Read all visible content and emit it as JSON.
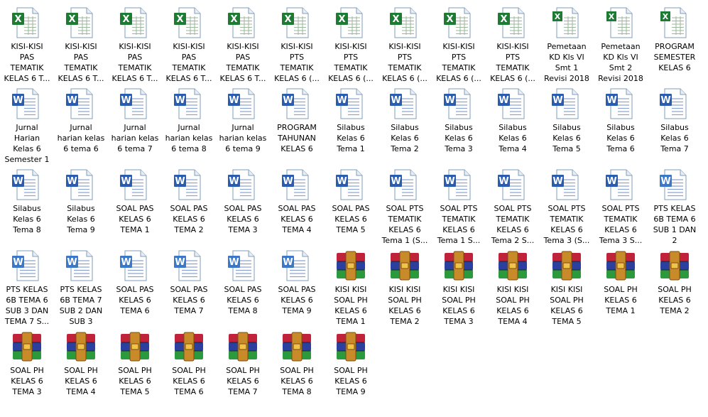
{
  "colors": {
    "excel_green": "#1e7b34",
    "word_blue": "#2a5cb0",
    "rar_red": "#c0223a",
    "rar_green": "#2a9a3c",
    "rar_blue": "#2b3f9e"
  },
  "files": [
    {
      "label": "KISI-KISI\nPAS\nTEMATIK\nKELAS 6 T...",
      "icon": "excel-icon"
    },
    {
      "label": "KISI-KISI\nPAS\nTEMATIK\nKELAS 6 T...",
      "icon": "excel-icon"
    },
    {
      "label": "KISI-KISI\nPAS\nTEMATIK\nKELAS 6 T...",
      "icon": "excel-icon"
    },
    {
      "label": "KISI-KISI\nPAS\nTEMATIK\nKELAS 6 T...",
      "icon": "excel-icon"
    },
    {
      "label": "KISI-KISI\nPAS\nTEMATIK\nKELAS 6 T...",
      "icon": "excel-icon"
    },
    {
      "label": "KISI-KISI\nPTS\nTEMATIK\nKELAS 6 (...",
      "icon": "excel-icon"
    },
    {
      "label": "KISI-KISI\nPTS\nTEMATIK\nKELAS 6 (...",
      "icon": "excel-icon"
    },
    {
      "label": "KISI-KISI\nPTS\nTEMATIK\nKELAS 6 (...",
      "icon": "excel-icon"
    },
    {
      "label": "KISI-KISI\nPTS\nTEMATIK\nKELAS 6 (...",
      "icon": "excel-icon"
    },
    {
      "label": "KISI-KISI\nPTS\nTEMATIK\nKELAS 6 (...",
      "icon": "excel-icon"
    },
    {
      "label": "Pemetaan\nKD Kls VI\nSmt 1\nRevisi 2018",
      "icon": "excel-sheet-icon"
    },
    {
      "label": "Pemetaan\nKD Kls VI\nSmt 2\nRevisi 2018",
      "icon": "excel-sheet-icon"
    },
    {
      "label": "PROGRAM\nSEMESTER\nKELAS 6",
      "icon": "excel-sheet-icon"
    },
    {
      "label": "Jurnal\nHarian\nKelas 6\nSemester 1",
      "icon": "word-icon"
    },
    {
      "label": "Jurnal\nharian kelas\n6 tema 6",
      "icon": "word-icon"
    },
    {
      "label": "Jurnal\nharian kelas\n6 tema 7",
      "icon": "word-icon"
    },
    {
      "label": "Jurnal\nharian kelas\n6 tema 8",
      "icon": "word-icon"
    },
    {
      "label": "Jurnal\nharian kelas\n6 tema 9",
      "icon": "word-icon"
    },
    {
      "label": "PROGRAM\nTAHUNAN\nKELAS 6",
      "icon": "word-icon"
    },
    {
      "label": "Silabus\nKelas 6\nTema 1",
      "icon": "word-icon"
    },
    {
      "label": "Silabus\nKelas 6\nTema 2",
      "icon": "word-icon"
    },
    {
      "label": "Silabus\nKelas 6\nTema 3",
      "icon": "word-icon"
    },
    {
      "label": "Silabus\nKelas 6\nTema 4",
      "icon": "word-icon"
    },
    {
      "label": "Silabus\nKelas 6\nTema 5",
      "icon": "word-icon"
    },
    {
      "label": "Silabus\nKelas 6\nTema 6",
      "icon": "word-icon"
    },
    {
      "label": "Silabus\nKelas 6\nTema 7",
      "icon": "word-icon"
    },
    {
      "label": "Silabus\nKelas 6\nTema 8",
      "icon": "word-icon"
    },
    {
      "label": "Silabus\nKelas 6\nTema 9",
      "icon": "word-icon"
    },
    {
      "label": "SOAL PAS\nKELAS 6\nTEMA 1",
      "icon": "word-icon"
    },
    {
      "label": "SOAL PAS\nKELAS 6\nTEMA 2",
      "icon": "word-icon"
    },
    {
      "label": "SOAL PAS\nKELAS 6\nTEMA 3",
      "icon": "word-icon"
    },
    {
      "label": "SOAL PAS\nKELAS 6\nTEMA 4",
      "icon": "word-icon"
    },
    {
      "label": "SOAL PAS\nKELAS 6\nTEMA 5",
      "icon": "word-icon"
    },
    {
      "label": "SOAL PTS\nTEMATIK\nKELAS 6\nTema 1 (S...",
      "icon": "word-icon"
    },
    {
      "label": "SOAL PTS\nTEMATIK\nKELAS 6\nTema 1 S...",
      "icon": "word-icon"
    },
    {
      "label": "SOAL PTS\nTEMATIK\nKELAS 6\nTema 2 S...",
      "icon": "word-icon"
    },
    {
      "label": "SOAL PTS\nTEMATIK\nKELAS 6\nTema 3 (S...",
      "icon": "word-icon"
    },
    {
      "label": "SOAL PTS\nTEMATIK\nKELAS 6\nTema 3 S...",
      "icon": "word-icon"
    },
    {
      "label": "PTS KELAS\n6B TEMA 6\nSUB 1 DAN\n2",
      "icon": "word-old-icon"
    },
    {
      "label": "PTS KELAS\n6B TEMA 6\nSUB 3 DAN\nTEMA 7 S...",
      "icon": "word-old-icon"
    },
    {
      "label": "PTS KELAS\n6B TEMA 7\nSUB 2 DAN\nSUB 3",
      "icon": "word-old-icon"
    },
    {
      "label": "SOAL PAS\nKELAS 6\nTEMA 6",
      "icon": "word-old-icon"
    },
    {
      "label": "SOAL PAS\nKELAS 6\nTEMA 7",
      "icon": "word-old-icon"
    },
    {
      "label": "SOAL PAS\nKELAS 6\nTEMA 8",
      "icon": "word-old-icon"
    },
    {
      "label": "SOAL PAS\nKELAS 6\nTEMA 9",
      "icon": "word-old-icon"
    },
    {
      "label": "KISI KISI\nSOAL PH\nKELAS 6\nTEMA 1",
      "icon": "winrar-icon"
    },
    {
      "label": "KISI KISI\nSOAL PH\nKELAS 6\nTEMA 2",
      "icon": "winrar-icon"
    },
    {
      "label": "KISI KISI\nSOAL PH\nKELAS 6\nTEMA 3",
      "icon": "winrar-icon"
    },
    {
      "label": "KISI KISI\nSOAL PH\nKELAS 6\nTEMA 4",
      "icon": "winrar-icon"
    },
    {
      "label": "KISI KISI\nSOAL PH\nKELAS 6\nTEMA 5",
      "icon": "winrar-icon"
    },
    {
      "label": "SOAL PH\nKELAS 6\nTEMA 1",
      "icon": "winrar-icon"
    },
    {
      "label": "SOAL PH\nKELAS 6\nTEMA 2",
      "icon": "winrar-icon"
    },
    {
      "label": "SOAL PH\nKELAS 6\nTEMA 3",
      "icon": "winrar-icon"
    },
    {
      "label": "SOAL PH\nKELAS 6\nTEMA 4",
      "icon": "winrar-icon"
    },
    {
      "label": "SOAL PH\nKELAS 6\nTEMA 5",
      "icon": "winrar-icon"
    },
    {
      "label": "SOAL PH\nKELAS 6\nTEMA 6",
      "icon": "winrar-icon"
    },
    {
      "label": "SOAL PH\nKELAS 6\nTEMA 7",
      "icon": "winrar-icon"
    },
    {
      "label": "SOAL PH\nKELAS 6\nTEMA 8",
      "icon": "winrar-icon"
    },
    {
      "label": "SOAL PH\nKELAS 6\nTEMA 9",
      "icon": "winrar-icon"
    }
  ]
}
